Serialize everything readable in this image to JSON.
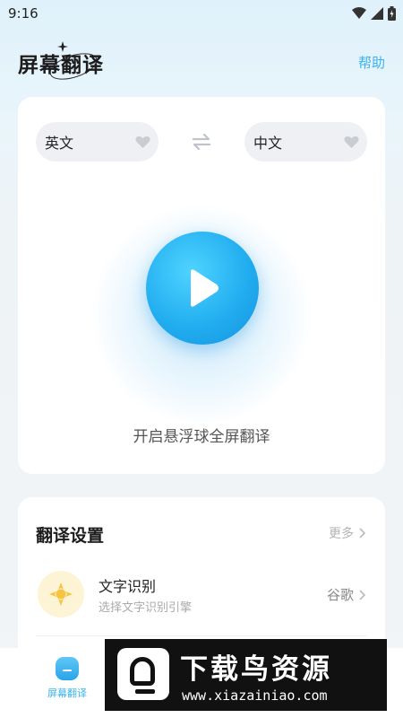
{
  "status_bar": {
    "time": "9:16",
    "icons": [
      "wifi-icon",
      "signal-icon",
      "battery-icon"
    ]
  },
  "header": {
    "title": "屏幕翻译",
    "help_label": "帮助"
  },
  "languages": {
    "source": "英文",
    "target": "中文",
    "swap_icon": "swap-arrows-icon"
  },
  "main": {
    "start_caption": "开启悬浮球全屏翻译",
    "start_icon": "play-icon"
  },
  "settings": {
    "title": "翻译设置",
    "more_label": "更多",
    "ocr": {
      "name": "文字识别",
      "description": "选择文字识别引擎",
      "value": "谷歌"
    }
  },
  "bottom_nav": {
    "items": [
      {
        "label": "屏幕翻译",
        "active": true
      }
    ]
  },
  "watermark": {
    "text": "下载鸟资源",
    "url": "www.xiazainiao.com"
  },
  "colors": {
    "accent": "#39b3ea",
    "button": "#22aef0",
    "ocr_icon": "#f6c443"
  }
}
